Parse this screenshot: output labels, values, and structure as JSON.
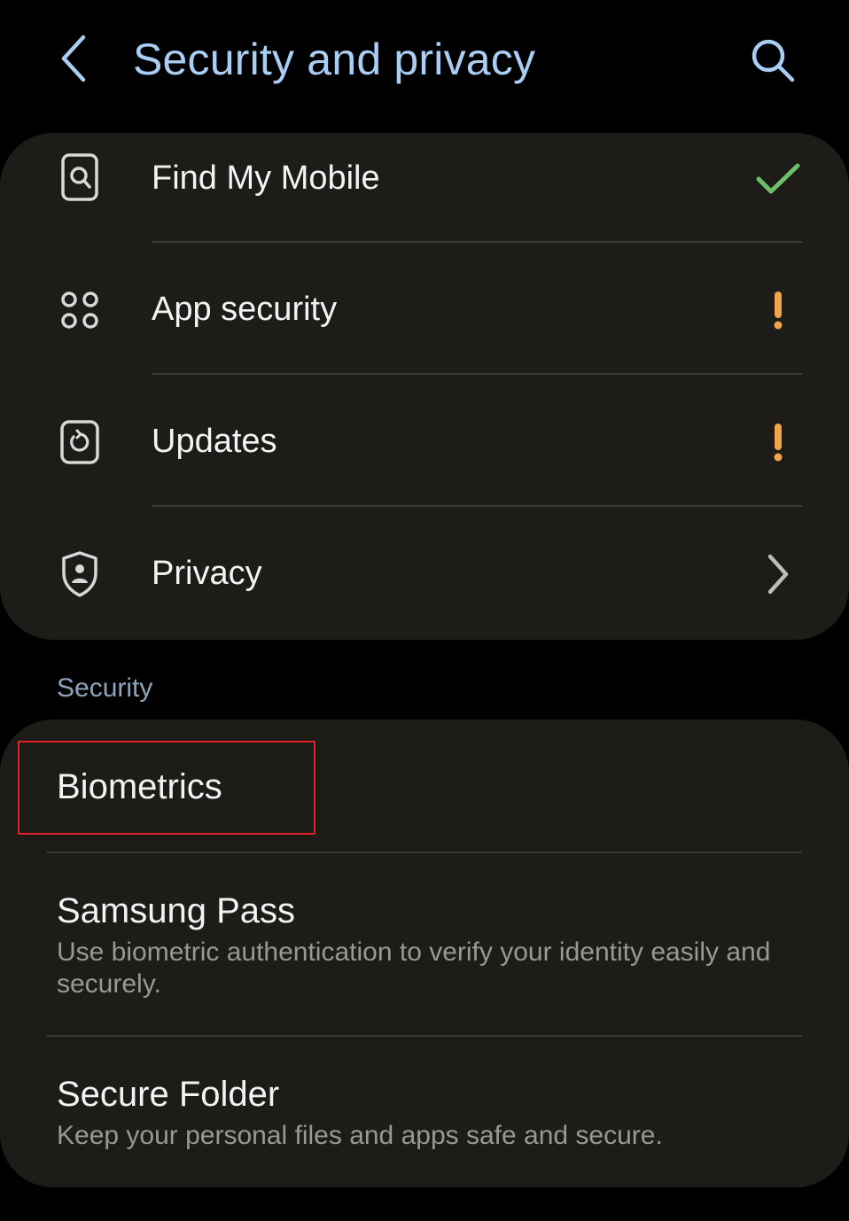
{
  "header": {
    "title": "Security and privacy",
    "back_icon": "chevron-left-icon",
    "search_icon": "search-icon"
  },
  "top_group": {
    "items": [
      {
        "label": "Find My Mobile",
        "icon": "find-my-mobile-icon",
        "status": "check",
        "status_color": "#6fc06a"
      },
      {
        "label": "App security",
        "icon": "apps-grid-icon",
        "status": "warning",
        "status_color": "#f2a44b"
      },
      {
        "label": "Updates",
        "icon": "updates-icon",
        "status": "warning",
        "status_color": "#f2a44b"
      },
      {
        "label": "Privacy",
        "icon": "shield-user-icon",
        "status": "chevron-right",
        "status_color": "#bdbdbd"
      }
    ]
  },
  "security_section": {
    "header": "Security",
    "items": [
      {
        "label": "Biometrics",
        "sub": ""
      },
      {
        "label": "Samsung Pass",
        "sub": "Use biometric authentication to verify your identity easily and securely."
      },
      {
        "label": "Secure Folder",
        "sub": "Keep your personal files and apps safe and secure."
      }
    ]
  },
  "colors": {
    "background": "#000000",
    "card": "#1d1c19",
    "title": "#a9cdf3",
    "highlight": "#e0212a"
  }
}
